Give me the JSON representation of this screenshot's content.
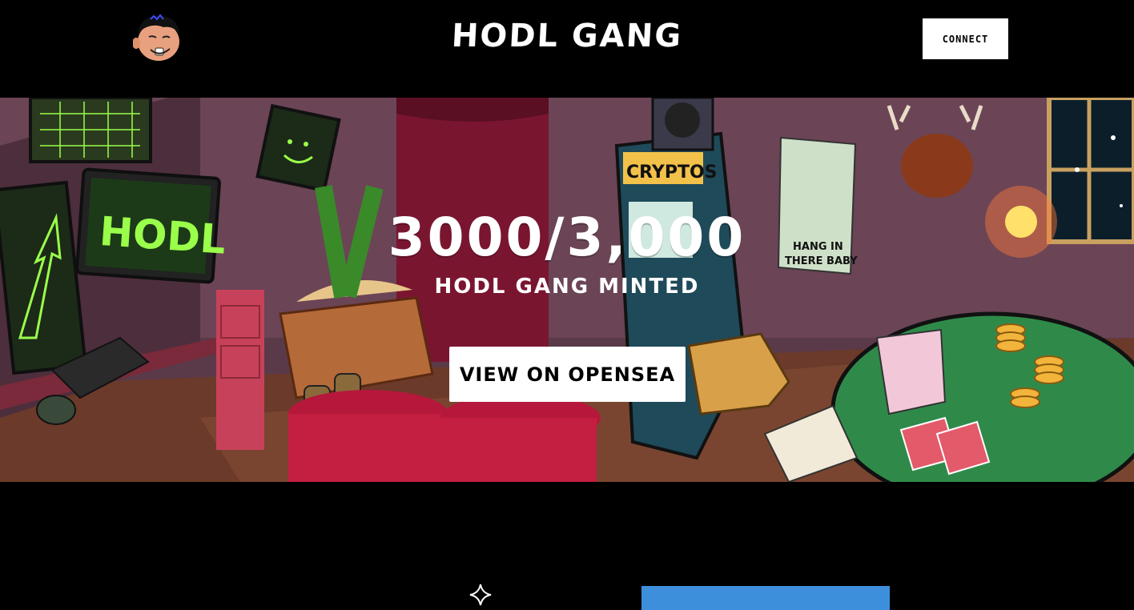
{
  "header": {
    "logo_icon": "hodl-gang-face-logo",
    "title": "HODL GANG",
    "connect_label": "CONNECT"
  },
  "hero": {
    "minted_count": "3000/3,000",
    "minted_label": "HODL GANG MINTED",
    "cta_label": "VIEW ON OPENSEA",
    "scene_texts": {
      "monitor": "HODL",
      "arcade": "CRYPTOS",
      "poster": "HANG IN THERE BABY"
    }
  },
  "footer_preview": {
    "sparkle_icon": "sparkle-icon",
    "accent_color": "#3d8fdc"
  }
}
